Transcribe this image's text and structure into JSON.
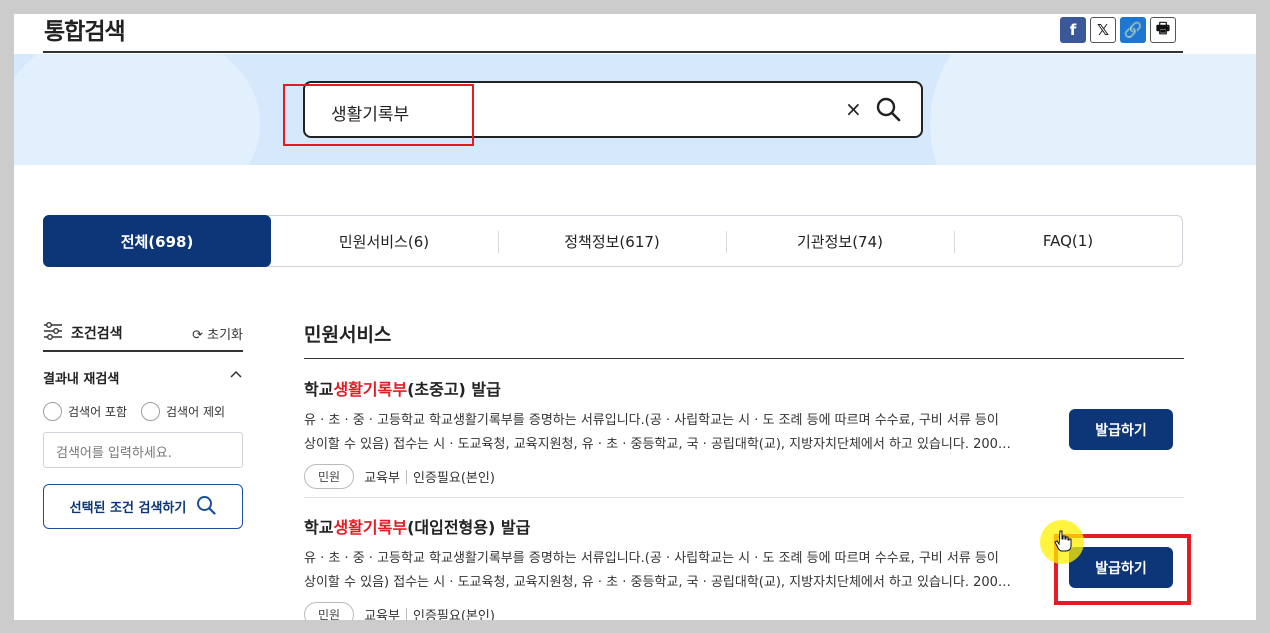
{
  "header": {
    "title": "통합검색",
    "share_icons": [
      "facebook-icon",
      "x-icon",
      "link-icon",
      "print-icon"
    ],
    "share_glyphs": [
      "f",
      "𝕏",
      "🔗",
      "🖶"
    ]
  },
  "search": {
    "query": "생활기록부",
    "clear_glyph": "×"
  },
  "tabs": [
    {
      "label": "전체(698)",
      "active": true
    },
    {
      "label": "민원서비스(6)",
      "active": false
    },
    {
      "label": "정책정보(617)",
      "active": false
    },
    {
      "label": "기관정보(74)",
      "active": false
    },
    {
      "label": "FAQ(1)",
      "active": false
    }
  ],
  "sidebar": {
    "title": "조건검색",
    "reset": "초기화",
    "refine_title": "결과내 재검색",
    "include_label": "검색어 포함",
    "exclude_label": "검색어 제외",
    "input_placeholder": "검색어를 입력하세요.",
    "search_button": "선택된 조건 검색하기"
  },
  "results": {
    "section_title": "민원서비스",
    "items": [
      {
        "title_prefix": "학교",
        "title_highlight": "생활기록부",
        "title_suffix": "(초중고) 발급",
        "desc_line1": "유 · 초 · 중 · 고등학교 학교생활기록부를 증명하는 서류입니다.(공 · 사립학교는 시 · 도 조례 등에 따르며 수수료, 구비 서류 등이",
        "desc_line2": "상이할 수 있음) 접수는 시 · 도교육청, 교육지원청, 유 · 초 · 중등학교, 국 · 공립대학(교), 지방자치단체에서 하고 있습니다. 200…",
        "badge": "민원",
        "agency": "교육부",
        "auth": "인증필요(본인)",
        "button": "발급하기"
      },
      {
        "title_prefix": "학교",
        "title_highlight": "생활기록부",
        "title_suffix": "(대입전형용) 발급",
        "desc_line1": "유 · 초 · 중 · 고등학교 학교생활기록부를 증명하는 서류입니다.(공 · 사립학교는 시 · 도 조례 등에 따르며 수수료, 구비 서류 등이",
        "desc_line2": "상이할 수 있음) 접수는 시 · 도교육청, 교육지원청, 유 · 초 · 중등학교, 국 · 공립대학(교), 지방자치단체에서 하고 있습니다. 200…",
        "badge": "민원",
        "agency": "교육부",
        "auth": "인증필요(본인)",
        "button": "발급하기"
      }
    ]
  },
  "colors": {
    "primary": "#0c3677",
    "highlight": "#e41b23",
    "banner": "#d6e8fb"
  }
}
